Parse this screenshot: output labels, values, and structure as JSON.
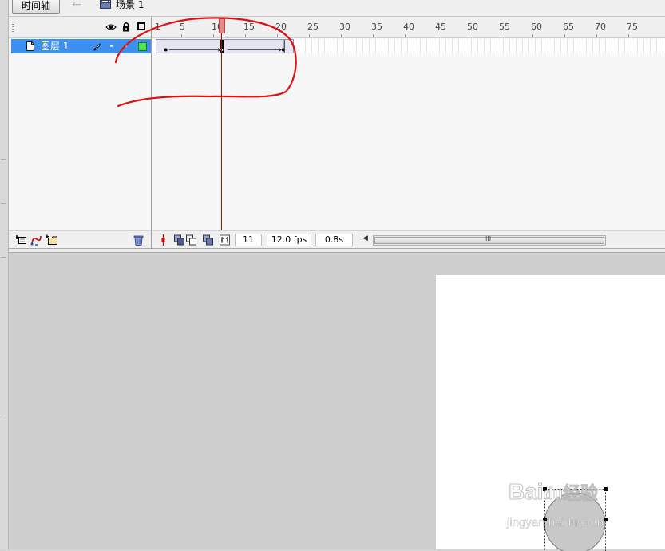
{
  "toolbar": {
    "tab_label": "时间轴",
    "back_icon": "back-arrow-icon",
    "scene_icon": "clapperboard-icon",
    "scene_label": "场景 1"
  },
  "layers": {
    "header_icons": [
      "eye-icon",
      "lock-icon",
      "outline-icon"
    ],
    "items": [
      {
        "name": "图层 1",
        "color": "#4fe34f",
        "selected": true
      }
    ],
    "footer_icons": [
      "add-layer-icon",
      "add-guide-layer-icon",
      "add-folder-icon",
      "delete-icon"
    ]
  },
  "timeline": {
    "ruler_labels": [
      "1",
      "5",
      "10",
      "15",
      "20",
      "25",
      "30",
      "35",
      "40",
      "45",
      "50",
      "55",
      "60",
      "65",
      "70",
      "75"
    ],
    "current_frame": "11",
    "fps": "12.0 fps",
    "elapsed": "0.8s",
    "footer_icons": [
      "center-frame-icon",
      "onion-skin-icon",
      "onion-outline-icon",
      "edit-multiple-frames-icon",
      "onion-markers-icon"
    ],
    "scroll_grip": "III",
    "colors": {
      "selection": "#3d8ff0",
      "playhead": "#cc0000",
      "annotation": "#dd1111"
    }
  },
  "watermark": {
    "brand": "Bai",
    "brand_du": "du",
    "brand_cn": "经验",
    "url": "jingyan.baidu.com"
  }
}
